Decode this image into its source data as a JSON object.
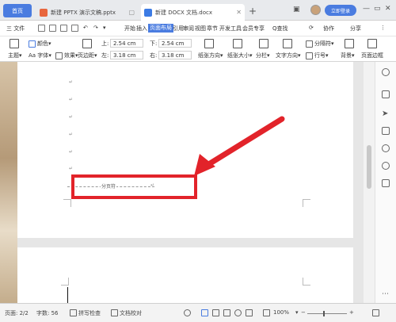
{
  "titlebar": {
    "home_tab": "首页",
    "tabs": [
      {
        "label": "新建 PPTX 演示文稿.pptx",
        "badge_color": "#e8663d"
      },
      {
        "label": "新建 DOCX 文档.docx",
        "badge_color": "#3c7be4"
      }
    ],
    "login_button": "立即登录"
  },
  "menubar": {
    "file": "三 文件",
    "tabs": [
      "开始",
      "插入",
      "页面布局",
      "引用",
      "审阅",
      "视图",
      "章节",
      "开发工具",
      "会员专享"
    ],
    "active_tab": "页面布局",
    "search": "Q查找",
    "collab": "协作",
    "share": "分享"
  },
  "ribbon": {
    "theme": "主题",
    "colors": "颜色",
    "fonts": "Aa 字体",
    "effects": "效果",
    "margins": "页边距",
    "top_label": "上:",
    "top_value": "2.54 cm",
    "bottom_label": "下:",
    "bottom_value": "2.54 cm",
    "left_label": "左:",
    "left_value": "3.18 cm",
    "right_label": "右:",
    "right_value": "3.18 cm",
    "orientation": "纸张方向",
    "size": "纸张大小",
    "columns": "分栏",
    "text_direction": "文字方向",
    "breaks": "分隔符",
    "line_numbers": "行号",
    "background": "背景",
    "border": "页面边框"
  },
  "document": {
    "para_mark": "↵",
    "page_break_label": "分页符"
  },
  "statusbar": {
    "page": "页面: 2/2",
    "words": "字数: 56",
    "spellcheck": "拼写检查",
    "proofread": "文档校对",
    "zoom": "100%"
  },
  "colors": {
    "accent": "#4a7ce0",
    "highlight_red": "#e2232a"
  }
}
